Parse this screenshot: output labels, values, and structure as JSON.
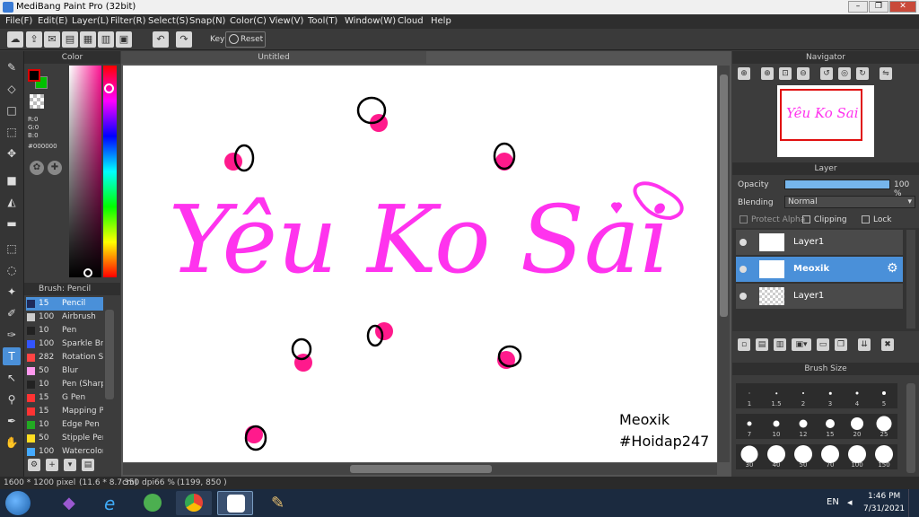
{
  "window": {
    "title": "MediBang Paint Pro (32bit)",
    "btn_min": "–",
    "btn_max": "❐",
    "btn_close": "✕"
  },
  "menu": [
    "File(F)",
    "Edit(E)",
    "Layer(L)",
    "Filter(R)",
    "Select(S)",
    "Snap(N)",
    "Color(C)",
    "View(V)",
    "Tool(T)",
    "Window(W)",
    "Cloud",
    "Help"
  ],
  "toolbar": {
    "key_label": "Key",
    "reset_label": "Reset"
  },
  "color_panel": {
    "title": "Color",
    "r": "R:0",
    "g": "G:0",
    "b": "B:0",
    "hex": "#000000",
    "fg": "#000000",
    "bg": "#00c000"
  },
  "brush_panel": {
    "title": "Brush: Pencil",
    "items": [
      {
        "size": "15",
        "name": "Pencil",
        "color": "#1e2a5a"
      },
      {
        "size": "100",
        "name": "Airbrush",
        "color": "#cccccc"
      },
      {
        "size": "10",
        "name": "Pen",
        "color": "#222222"
      },
      {
        "size": "100",
        "name": "Sparkle Brush",
        "color": "#3355ff"
      },
      {
        "size": "282",
        "name": "Rotation Symmetry",
        "color": "#ff4444"
      },
      {
        "size": "50",
        "name": "Blur",
        "color": "#ff99ee"
      },
      {
        "size": "10",
        "name": "Pen (Sharp)",
        "color": "#222222"
      },
      {
        "size": "15",
        "name": "G Pen",
        "color": "#ff3333"
      },
      {
        "size": "15",
        "name": "Mapping Pen",
        "color": "#ff3333"
      },
      {
        "size": "10",
        "name": "Edge Pen",
        "color": "#22aa22"
      },
      {
        "size": "50",
        "name": "Stipple Pen",
        "color": "#ffdd22"
      },
      {
        "size": "100",
        "name": "Watercolor",
        "color": "#44aaff"
      }
    ]
  },
  "canvas": {
    "tab_title": "Untitled",
    "main_text": "Yêu Ko Sai",
    "signature_line1": "Meoxik",
    "signature_line2": "#Hoidap247",
    "ink_color": "#ff33ee",
    "dot_color": "#ff1a8c"
  },
  "navigator": {
    "title": "Navigator",
    "thumb_text": "Yêu Ko Sai"
  },
  "layer_panel": {
    "title": "Layer",
    "opacity_label": "Opacity",
    "opacity_value": "100 %",
    "opacity_fraction": 1.0,
    "blending_label": "Blending",
    "blending_value": "Normal",
    "protect_alpha": "Protect Alpha",
    "clipping": "Clipping",
    "lock": "Lock",
    "layers": [
      {
        "name": "Layer1",
        "selected": false
      },
      {
        "name": "Meoxik",
        "selected": true
      },
      {
        "name": "Layer1",
        "selected": false
      }
    ]
  },
  "brush_size": {
    "title": "Brush Size",
    "sizes": [
      "1",
      "1.5",
      "2",
      "3",
      "4",
      "5",
      "7",
      "10",
      "12",
      "15",
      "20",
      "25",
      "30",
      "40",
      "50",
      "70",
      "100",
      "150"
    ]
  },
  "status": {
    "dims": "1600 * 1200 pixel",
    "cm": "(11.6 * 8.7cm)",
    "dpi": "350 dpi",
    "zoom": "66 %",
    "coords": "(1199, 850 )"
  },
  "taskbar": {
    "lang": "EN",
    "time": "1:46 PM",
    "date": "7/31/2021"
  }
}
